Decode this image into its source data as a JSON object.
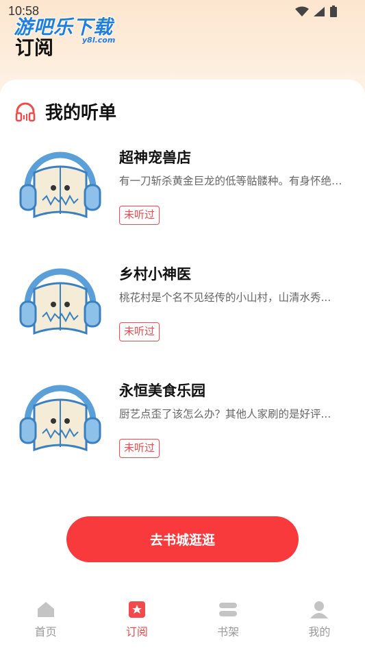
{
  "status_bar": {
    "time": "10:58"
  },
  "watermark": {
    "text": "游吧乐下载",
    "sub": "y8l.com"
  },
  "header": {
    "title": "订阅"
  },
  "section": {
    "title": "我的听单",
    "icon": "headphones-icon"
  },
  "books": [
    {
      "title": "超神宠兽店",
      "description": "有一刀斩杀黄金巨龙的低等骷髅种。有身怀绝技的...",
      "tag": "未听过"
    },
    {
      "title": "乡村小神医",
      "description": "桃花村是个名不见经传的小山村，山清水秀...",
      "tag": "未听过"
    },
    {
      "title": "永恒美食乐园",
      "description": "厨艺点歪了该怎么办？其他人家刷的是好评...",
      "tag": "未听过"
    }
  ],
  "cta": {
    "label": "去书城逛逛"
  },
  "tabbar": [
    {
      "label": "首页",
      "icon": "home-icon",
      "active": false
    },
    {
      "label": "订阅",
      "icon": "bookmark-icon",
      "active": true
    },
    {
      "label": "书架",
      "icon": "bookshelf-icon",
      "active": false
    },
    {
      "label": "我的",
      "icon": "user-icon",
      "active": false
    }
  ],
  "colors": {
    "accent": "#f83a3d",
    "tag": "#f04a4a",
    "header_bg": "#fde6cf",
    "inactive": "#999999"
  }
}
